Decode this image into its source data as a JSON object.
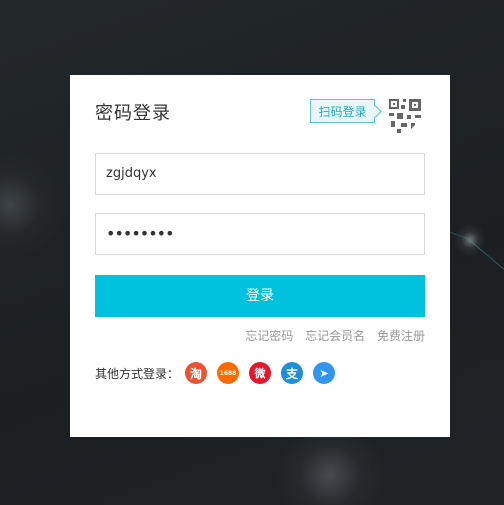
{
  "login": {
    "title": "密码登录",
    "qr_tip": "扫码登录",
    "username_value": "zgjdqyx",
    "password_value": "••••••••",
    "submit_label": "登录",
    "links": {
      "forgot_password": "忘记密码",
      "forgot_member": "忘记会员名",
      "register": "免费注册"
    },
    "other_login_label": "其他方式登录：",
    "social": [
      {
        "name": "taobao",
        "glyph": "淘"
      },
      {
        "name": "1688",
        "glyph": "1688"
      },
      {
        "name": "weibo",
        "glyph": "微"
      },
      {
        "name": "zhifubao",
        "glyph": "支"
      },
      {
        "name": "dingtalk",
        "glyph": "➤"
      }
    ]
  },
  "colors": {
    "accent": "#00c1de",
    "background": "#1d2124"
  }
}
